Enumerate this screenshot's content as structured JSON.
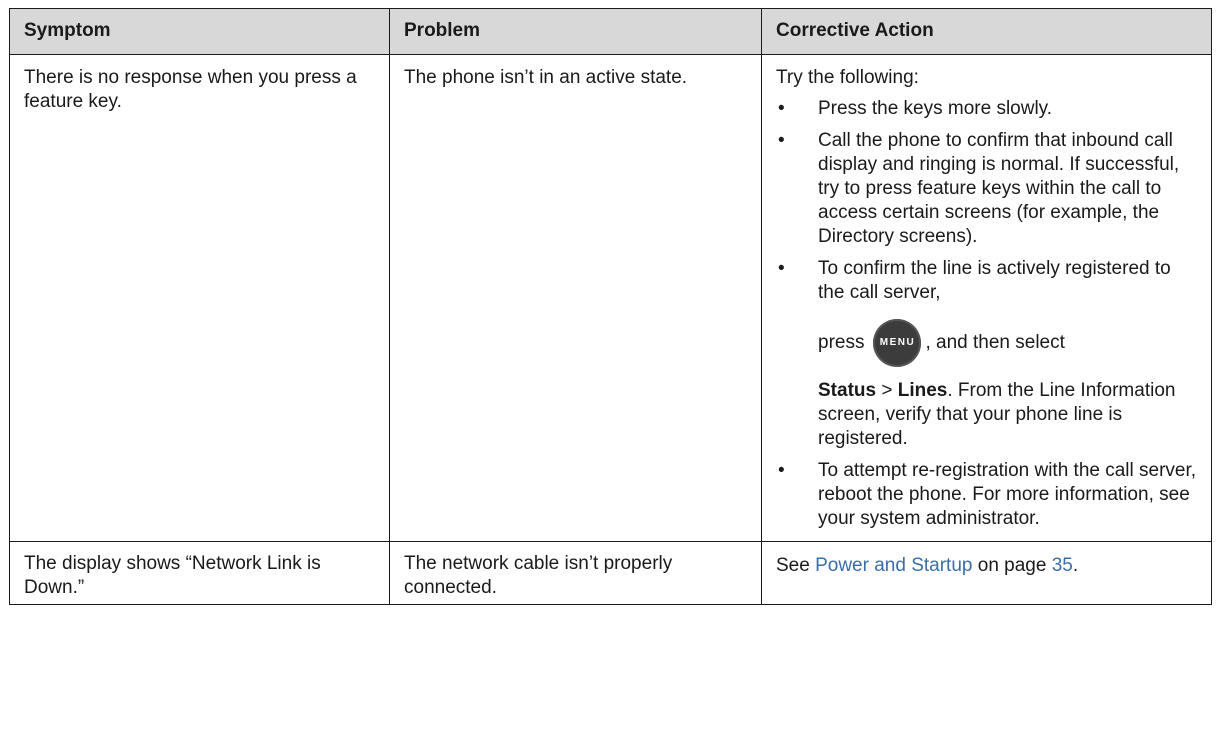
{
  "headers": {
    "symptom": "Symptom",
    "problem": "Problem",
    "action": "Corrective Action"
  },
  "row1": {
    "symptom": "There is no response when you press a feature key.",
    "problem": "The phone isn’t in an active state.",
    "intro": "Try the following:",
    "bullet_char": "•",
    "items": [
      "Press the keys more slowly.",
      "Call the phone to confirm that inbound call display and ringing is normal. If successful, try to press feature keys within the call to access certain screens (for example, the Directory screens).",
      "To confirm the line is actively registered to the call server,",
      "To attempt re-registration with the call server, reboot the phone. For more information, see your system administrator."
    ],
    "press_word": "press",
    "menu_key_label": "MENU",
    "press_suffix": ", and then select",
    "status_label": "Status",
    "separator": " > ",
    "lines_label": "Lines",
    "status_after": ". From the Line Information screen, verify that your phone line is registered."
  },
  "row2": {
    "symptom": "The display shows “Network Link is Down.”",
    "problem": "The network cable isn’t properly connected.",
    "action_prefix": "See ",
    "action_link": "Power and Startup",
    "action_middle": " on page ",
    "action_page": "35",
    "action_suffix": "."
  },
  "colors": {
    "header_bg": "#d8d8d8",
    "link": "#3a6ea8",
    "menu_key": "#3c3c3c"
  },
  "icons": {
    "menu_key": "menu-key-icon"
  }
}
